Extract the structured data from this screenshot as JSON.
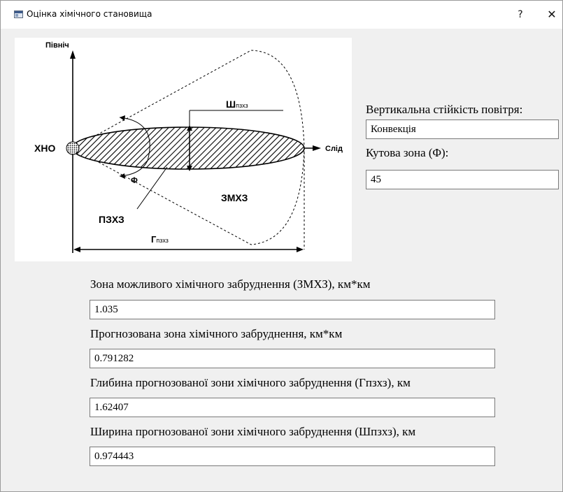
{
  "window": {
    "title": "Оцінка хімічного становища",
    "help_label": "?",
    "close_label": "✕"
  },
  "diagram": {
    "north_label": "Північ",
    "trace_label": "Слід",
    "source_label": "ХНО",
    "width_label_main": "Ш",
    "width_label_sub": "пзхз",
    "angle_label": "Φ",
    "zmkhz_label": "ЗМХЗ",
    "pzkhz_label": "ПЗХЗ",
    "depth_label_main": "Г",
    "depth_label_sub": "пзхз"
  },
  "side": {
    "stability_label": "Вертикальна стійкість повітря:",
    "stability_value": "Конвекція",
    "angle_zone_label": "Кутова зона (Φ):",
    "angle_zone_value": "45"
  },
  "results": [
    {
      "label": "Зона можливого хімічного забруднення (ЗМХЗ), км*км",
      "value": "1.035"
    },
    {
      "label": "Прогнозована зона хімічного забруднення, км*км",
      "value": "0.791282"
    },
    {
      "label": "Глибина прогнозованої зони хімічного забруднення (Гпзхз), км",
      "value": "1.62407"
    },
    {
      "label": "Ширина прогнозованої зони хімічного забруднення (Шпзхз), км",
      "value": "0.974443"
    }
  ]
}
